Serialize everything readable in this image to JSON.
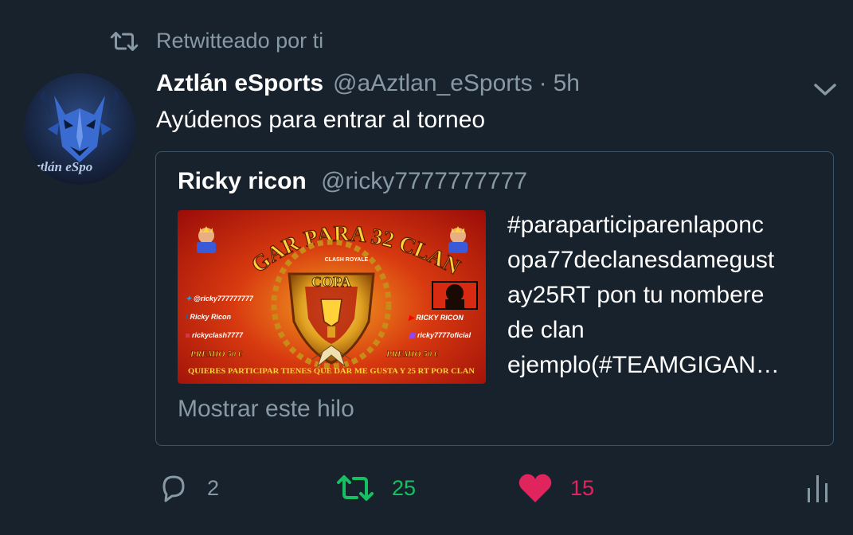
{
  "retweet_context": {
    "label": "Retwitteado por ti"
  },
  "tweet": {
    "author_name": "Aztlán eSports",
    "author_handle": "@aAztlan_eSports",
    "separator": "·",
    "time": "5h",
    "text": "Ayúdenos para entrar al torneo",
    "avatar_label": "ztlán eSpo"
  },
  "quoted_tweet": {
    "author_name": "Ricky ricon",
    "author_handle": "@ricky7777777777",
    "text_lines": [
      "#paraparticiparenlaponc",
      "opa77declanesdamegust",
      "ay25RT pon tu nombere",
      "de clan",
      "ejemplo(#TEAMGIGAN…"
    ],
    "image": {
      "title": "LUGAR PARA 32 CLANES",
      "copa": "COPA",
      "twitter": "@ricky777777777",
      "facebook": "Ricky Ricon",
      "instagram": "rickyclash7777",
      "youtube": "RICKY RICON",
      "twitch": "ricky7777oficial",
      "prize_left": "PREMIO 50 €",
      "prize_right": "PREMIO 50 €",
      "footer": "QUIERES PARTICIPAR TIENES QUE DAR ME GUSTA Y 25 RT POR CLAN",
      "badge": "CLASH ROYALE"
    },
    "show_thread": "Mostrar este hilo"
  },
  "actions": {
    "reply_count": "2",
    "retweet_count": "25",
    "like_count": "15"
  },
  "colors": {
    "background": "#18222d",
    "secondary_text": "#8899a6",
    "retweet_active": "#17bf63",
    "like_active": "#e0245e",
    "quote_border": "#3d5466"
  }
}
